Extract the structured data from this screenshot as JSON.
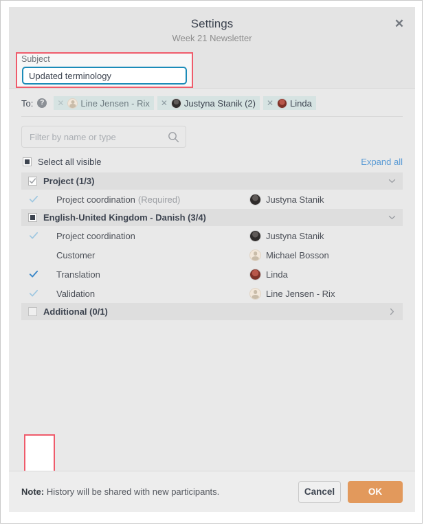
{
  "dialog": {
    "title": "Settings",
    "subtitle": "Week 21 Newsletter",
    "close_label": "✕"
  },
  "subject": {
    "label": "Subject",
    "value": "Updated terminology",
    "placeholder": ""
  },
  "recipients": {
    "to_label": "To:",
    "help_icon": "help-circle-icon",
    "help_glyph": "?",
    "chips": [
      {
        "name": "Line Jensen - Rix",
        "remove_glyph": "✕",
        "avatar": "placeholder",
        "disabled": true
      },
      {
        "name": "Justyna Stanik (2)",
        "remove_glyph": "✕",
        "avatar": "photo-dark",
        "disabled": false
      },
      {
        "name": "Linda",
        "remove_glyph": "✕",
        "avatar": "photo-red",
        "disabled": false
      }
    ]
  },
  "filter": {
    "placeholder": "Filter by name or type",
    "value": "",
    "icon": "search-icon"
  },
  "toolbar": {
    "select_all_label": "Select all visible",
    "select_all_state": "indeterminate",
    "expand_all_label": "Expand all",
    "expand_all_color": "#5b9bd5"
  },
  "tree": [
    {
      "kind": "group",
      "label": "Project (1/3)",
      "checkbox": "checked",
      "chevron": "chevron-down-icon",
      "expanded": true
    },
    {
      "kind": "leaf",
      "name": "Project coordination",
      "suffix": "(Required)",
      "tick": "light",
      "person": "Justyna Stanik",
      "avatar": "photo-dark"
    },
    {
      "kind": "group",
      "label": "English-United Kingdom - Danish (3/4)",
      "checkbox": "indeterminate",
      "chevron": "chevron-down-icon",
      "expanded": true
    },
    {
      "kind": "leaf",
      "name": "Project coordination",
      "suffix": "",
      "tick": "light",
      "person": "Justyna Stanik",
      "avatar": "photo-dark"
    },
    {
      "kind": "leaf",
      "name": "Customer",
      "suffix": "",
      "tick": "none",
      "person": "Michael Bosson",
      "avatar": "placeholder"
    },
    {
      "kind": "leaf",
      "name": "Translation",
      "suffix": "",
      "tick": "solid",
      "person": "Linda",
      "avatar": "photo-red"
    },
    {
      "kind": "leaf",
      "name": "Validation",
      "suffix": "",
      "tick": "light",
      "person": "Line Jensen - Rix",
      "avatar": "placeholder"
    },
    {
      "kind": "group",
      "label": "Additional (0/1)",
      "checkbox": "empty",
      "chevron": "chevron-right-icon",
      "expanded": false
    }
  ],
  "footer": {
    "note_prefix": "Note:",
    "note_text": "History will be shared with new participants.",
    "cancel_label": "Cancel",
    "ok_label": "OK",
    "ok_color": "#e2995c"
  },
  "annotations": {
    "highlight_color": "#ef5b6b",
    "subject_box": "subject-field-highlight",
    "ticks_box": "checkbox-column-highlight"
  }
}
